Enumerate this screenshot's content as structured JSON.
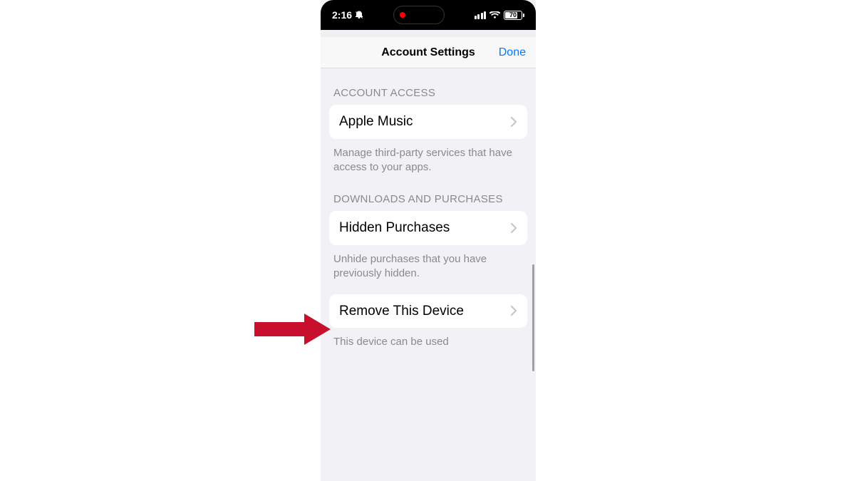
{
  "status": {
    "time": "2:16",
    "battery": "70"
  },
  "nav": {
    "title": "Account Settings",
    "done": "Done"
  },
  "sections": {
    "access": {
      "header": "ACCOUNT ACCESS",
      "row1": "Apple Music",
      "footer": "Manage third-party services that have access to your apps."
    },
    "downloads": {
      "header": "DOWNLOADS AND PURCHASES",
      "row1": "Hidden Purchases",
      "footer1": "Unhide purchases that you have previously hidden.",
      "row2": "Remove This Device",
      "footer2": "This device can be used"
    }
  },
  "colors": {
    "accent": "#007aff",
    "arrow": "#c8102e"
  }
}
